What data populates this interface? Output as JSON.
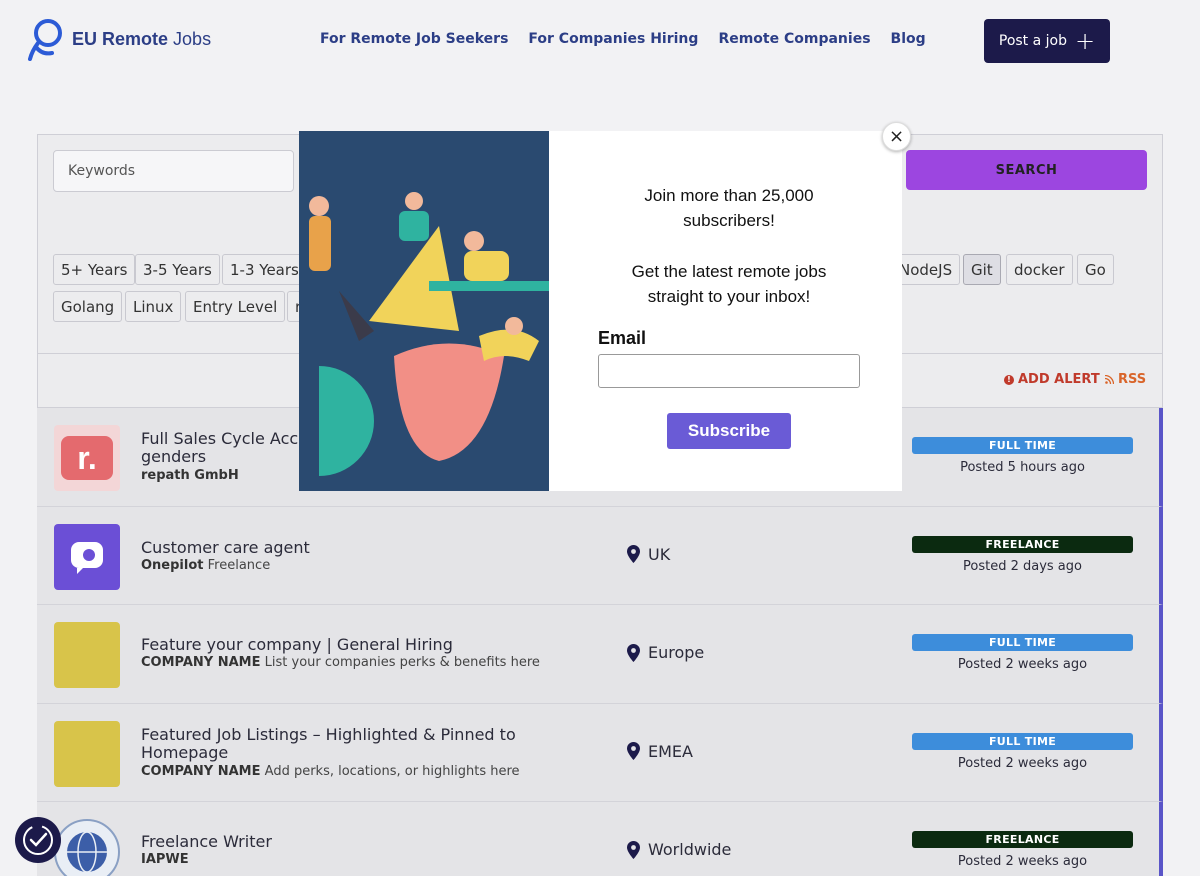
{
  "header": {
    "logo_bold": "EU Remote",
    "logo_light": "Jobs",
    "nav": [
      "For Remote Job Seekers",
      "For Companies Hiring",
      "Remote Companies",
      "Blog"
    ],
    "post_job_label": "Post a job"
  },
  "search": {
    "keywords_placeholder": "Keywords",
    "search_label": "SEARCH",
    "tags": [
      "5+ Years",
      "3-5 Years",
      "1-3 Years",
      "NodeJS",
      "Git",
      "docker",
      "Go",
      "Golang",
      "Linux",
      "Entry Level",
      "r"
    ],
    "active_tag": "Git"
  },
  "alerts": {
    "add_alert_label": "ADD ALERT",
    "rss_label": "RSS"
  },
  "jobs": [
    {
      "title": "Full Sales Cycle Account Executive (m/f/d) - all genders",
      "title_visible": "Full Sales Cycle Acco",
      "title_line2": "genders",
      "company": "repath GmbH",
      "extra": "",
      "location": "",
      "type": "FULL TIME",
      "posted": "Posted 5 hours ago",
      "logo_color": "#e46a6e"
    },
    {
      "title": "Customer care agent",
      "company": "Onepilot",
      "extra": "Freelance",
      "location": "UK",
      "type": "FREELANCE",
      "posted": "Posted 2 days ago",
      "logo_color": "#6b4fd6"
    },
    {
      "title": "Feature your company | General Hiring",
      "company": "COMPANY NAME",
      "extra": "List your companies perks & benefits here",
      "location": "Europe",
      "type": "FULL TIME",
      "posted": "Posted 2 weeks ago",
      "logo_color": "#d8c44a"
    },
    {
      "title": "Featured Job Listings – Highlighted & Pinned to Homepage",
      "company": "COMPANY NAME",
      "extra": "Add perks, locations, or highlights here",
      "location": "EMEA",
      "type": "FULL TIME",
      "posted": "Posted 2 weeks ago",
      "logo_color": "#d8c44a"
    },
    {
      "title": "Freelance Writer",
      "company": "IAPWE",
      "extra": "",
      "location": "Worldwide",
      "type": "FREELANCE",
      "posted": "Posted 2 weeks ago",
      "logo_color": "#e9eef5"
    }
  ],
  "modal": {
    "headline_1": "Join more than 25,000",
    "headline_2": "subscribers!",
    "sub_1": "Get the latest remote jobs",
    "sub_2": "straight to your inbox!",
    "email_label": "Email",
    "subscribe_label": "Subscribe",
    "close_label": "×"
  }
}
